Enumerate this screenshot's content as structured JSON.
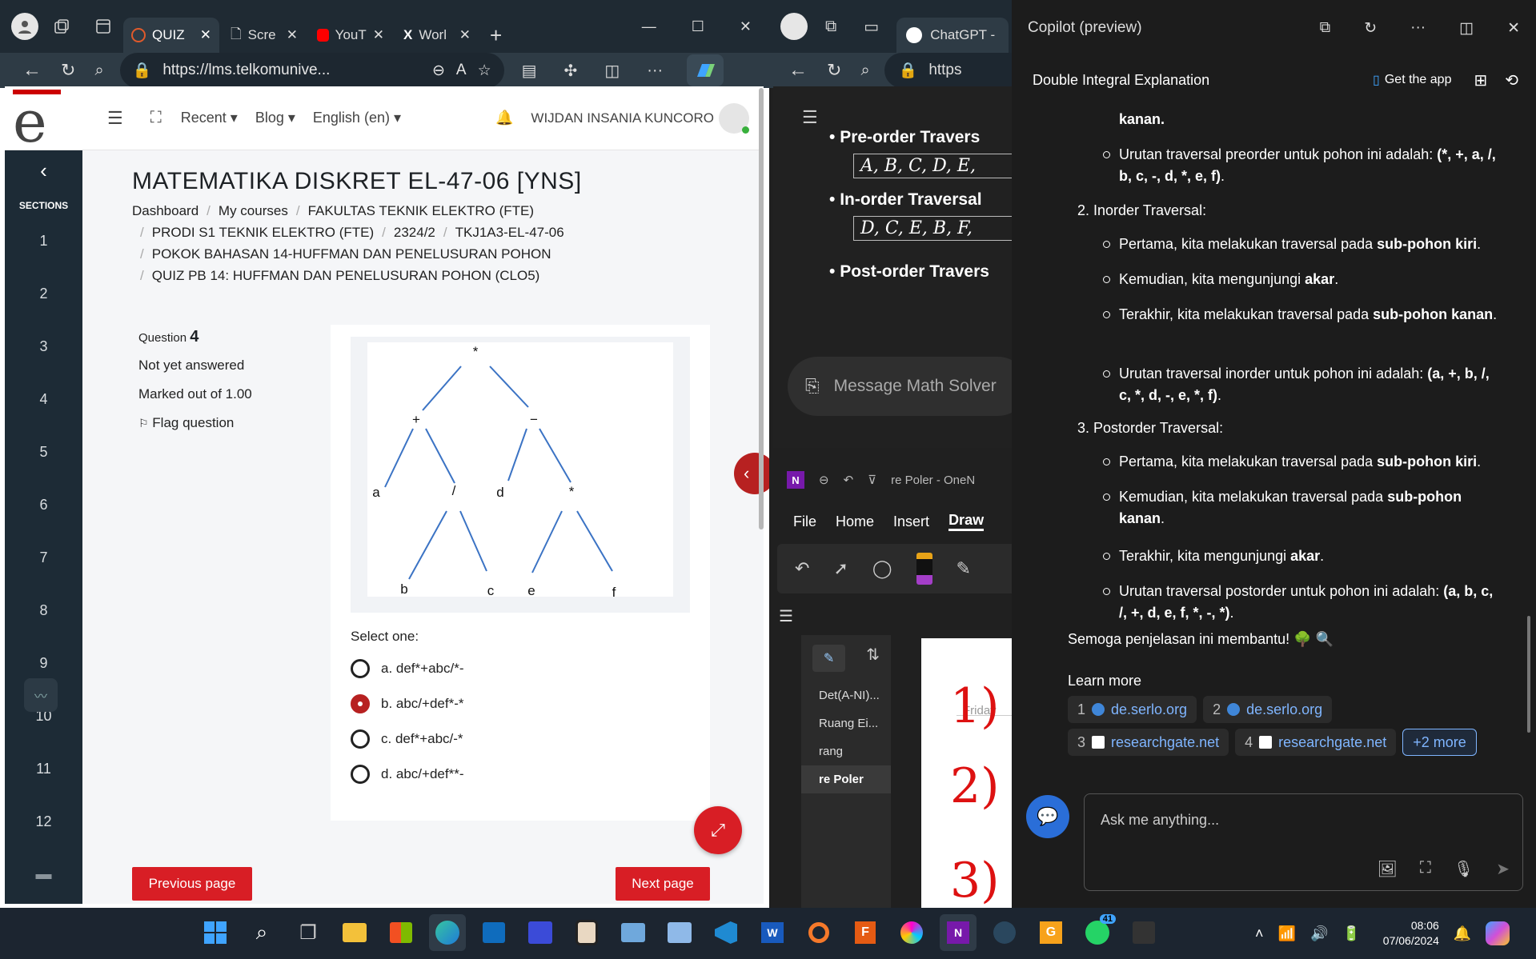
{
  "edge_left": {
    "tabs": [
      {
        "label": "QUIZ",
        "active": true
      },
      {
        "label": "Scre",
        "active": false
      },
      {
        "label": "YouT",
        "active": false
      },
      {
        "label": "Worl",
        "active": false
      }
    ],
    "url": "https://lms.telkomunive..."
  },
  "moodle": {
    "nav": {
      "recent": "Recent",
      "blog": "Blog",
      "language": "English (en)",
      "user": "WIJDAN INSANIA KUNCORO"
    },
    "sidebar": {
      "title": "SECTIONS",
      "items": [
        "1",
        "2",
        "3",
        "4",
        "5",
        "6",
        "7",
        "8",
        "9",
        "10",
        "11",
        "12"
      ]
    },
    "course_title": "MATEMATIKA DISKRET EL-47-06 [YNS]",
    "breadcrumb": [
      "Dashboard",
      "My courses",
      "FAKULTAS TEKNIK ELEKTRO (FTE)",
      "PRODI S1 TEKNIK ELEKTRO (FTE)",
      "2324/2",
      "TKJ1A3-EL-47-06",
      "POKOK BAHASAN 14-HUFFMAN DAN PENELUSURAN POHON",
      "QUIZ PB 14: HUFFMAN DAN PENELUSURAN POHON (CLO5)"
    ],
    "question": {
      "label": "Question",
      "number": "4",
      "status": "Not yet answered",
      "marks": "Marked out of 1.00",
      "flag": "Flag question"
    },
    "tree_nodes": [
      "*",
      "+",
      "−",
      "a",
      "/",
      "d",
      "*",
      "b",
      "c",
      "e",
      "f"
    ],
    "select_one": "Select one:",
    "options": [
      {
        "text": "a. def*+abc/*-",
        "selected": false
      },
      {
        "text": "b. abc/+def*-*",
        "selected": true
      },
      {
        "text": "c. def*+abc/-*",
        "selected": false
      },
      {
        "text": "d. abc/+def**-",
        "selected": false
      }
    ],
    "prev": "Previous page",
    "next": "Next page"
  },
  "middle": {
    "tab": "ChatGPT -",
    "url": "https",
    "chat": [
      {
        "title": "Pre-order Travers",
        "math": "A, B, C, D, E,"
      },
      {
        "title": "In-order Traversal",
        "math": "D, C, E, B, F,"
      },
      {
        "title": "Post-order Travers",
        "math": ""
      }
    ],
    "message_placeholder": "Message Math Solver",
    "onenote": {
      "title": "re Poler  -  OneN",
      "menu": [
        "File",
        "Home",
        "Insert",
        "Draw"
      ],
      "pages": [
        "Det(A-NI)...",
        "Ruang Ei...",
        "rang",
        "re Poler"
      ],
      "page_date": "Friday",
      "ink": [
        "1)",
        "2)",
        "3)"
      ]
    }
  },
  "copilot": {
    "title": "Copilot (preview)",
    "conversation": "Double Integral Explanation",
    "get_app": "Get the app",
    "top_fragment": "kanan.",
    "preorder_line": {
      "text": "Urutan traversal preorder untuk pohon ini adalah: ",
      "bold": "(*, +, a, /, b, c, -, d, *, e, f)"
    },
    "inorder": {
      "heading": "2. Inorder Traversal:",
      "items": [
        [
          "Pertama, kita melakukan traversal pada ",
          "sub-pohon kiri",
          "."
        ],
        [
          "Kemudian, kita mengunjungi ",
          "akar",
          "."
        ],
        [
          "Terakhir, kita melakukan traversal pada ",
          "sub-pohon kanan",
          "."
        ],
        [
          "Urutan traversal inorder untuk pohon ini adalah: ",
          "(a, +, b, /, c, *, d, -, e, *, f)",
          "."
        ]
      ]
    },
    "postorder": {
      "heading": "3. Postorder Traversal:",
      "items": [
        [
          "Pertama, kita melakukan traversal pada ",
          "sub-pohon kiri",
          "."
        ],
        [
          "Kemudian, kita melakukan traversal pada ",
          "sub-pohon kanan",
          "."
        ],
        [
          "Terakhir, kita mengunjungi ",
          "akar",
          "."
        ],
        [
          "Urutan traversal postorder untuk pohon ini adalah: ",
          "(a, b, c, /, +, d, e, f, *, -, *)",
          "."
        ]
      ]
    },
    "closing": "Semoga penjelasan ini membantu! 🌳 🔍",
    "learn_more": "Learn more",
    "sources": [
      {
        "n": "1",
        "site": "de.serlo.org"
      },
      {
        "n": "2",
        "site": "de.serlo.org"
      },
      {
        "n": "3",
        "site": "researchgate.net"
      },
      {
        "n": "4",
        "site": "researchgate.net"
      }
    ],
    "more": "+2 more",
    "input_placeholder": "Ask me anything..."
  },
  "taskbar": {
    "time": "08:06",
    "date": "07/06/2024",
    "badge": "41"
  }
}
